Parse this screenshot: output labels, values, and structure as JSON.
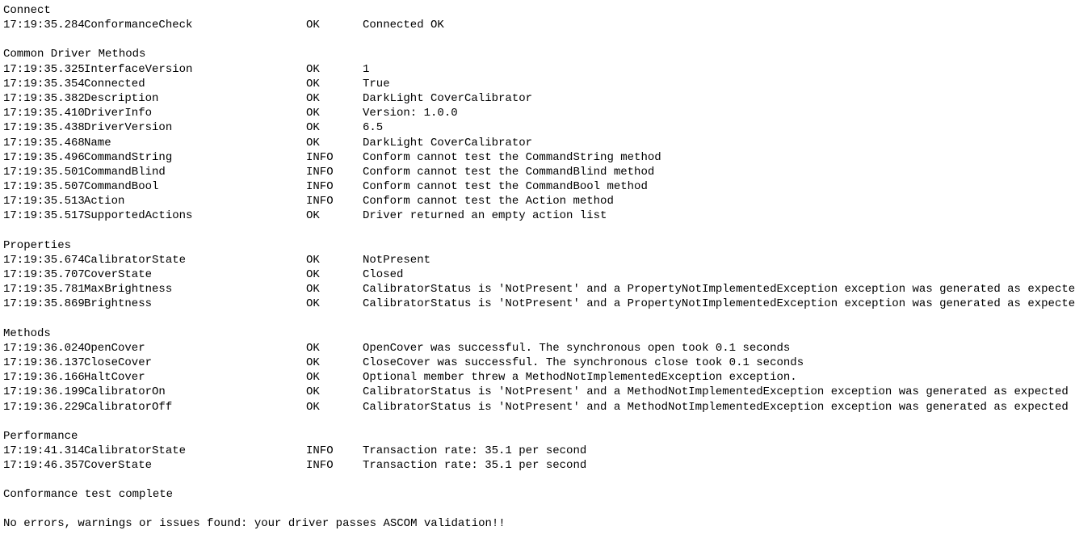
{
  "sections": [
    {
      "title": "Connect",
      "firstTop": false,
      "rows": [
        {
          "ts": "17:19:35.284",
          "name": "ConformanceCheck",
          "status": "OK",
          "msg": "Connected OK"
        }
      ]
    },
    {
      "title": "Common Driver Methods",
      "rows": [
        {
          "ts": "17:19:35.325",
          "name": "InterfaceVersion",
          "status": "OK",
          "msg": "1"
        },
        {
          "ts": "17:19:35.354",
          "name": "Connected",
          "status": "OK",
          "msg": "True"
        },
        {
          "ts": "17:19:35.382",
          "name": "Description",
          "status": "OK",
          "msg": "DarkLight CoverCalibrator"
        },
        {
          "ts": "17:19:35.410",
          "name": "DriverInfo",
          "status": "OK",
          "msg": "Version: 1.0.0"
        },
        {
          "ts": "17:19:35.438",
          "name": "DriverVersion",
          "status": "OK",
          "msg": "6.5"
        },
        {
          "ts": "17:19:35.468",
          "name": "Name",
          "status": "OK",
          "msg": "DarkLight CoverCalibrator"
        },
        {
          "ts": "17:19:35.496",
          "name": "CommandString",
          "status": "INFO",
          "msg": "Conform cannot test the CommandString method"
        },
        {
          "ts": "17:19:35.501",
          "name": "CommandBlind",
          "status": "INFO",
          "msg": "Conform cannot test the CommandBlind method"
        },
        {
          "ts": "17:19:35.507",
          "name": "CommandBool",
          "status": "INFO",
          "msg": "Conform cannot test the CommandBool method"
        },
        {
          "ts": "17:19:35.513",
          "name": "Action",
          "status": "INFO",
          "msg": "Conform cannot test the Action method"
        },
        {
          "ts": "17:19:35.517",
          "name": "SupportedActions",
          "status": "OK",
          "msg": "Driver returned an empty action list"
        }
      ]
    },
    {
      "title": "Properties",
      "rows": [
        {
          "ts": "17:19:35.674",
          "name": "CalibratorState",
          "status": "OK",
          "msg": "NotPresent"
        },
        {
          "ts": "17:19:35.707",
          "name": "CoverState",
          "status": "OK",
          "msg": "Closed"
        },
        {
          "ts": "17:19:35.781",
          "name": "MaxBrightness",
          "status": "OK",
          "msg": "CalibratorStatus is 'NotPresent' and a PropertyNotImplementedException exception was generated as expected"
        },
        {
          "ts": "17:19:35.869",
          "name": "Brightness",
          "status": "OK",
          "msg": "CalibratorStatus is 'NotPresent' and a PropertyNotImplementedException exception was generated as expected"
        }
      ]
    },
    {
      "title": "Methods",
      "rows": [
        {
          "ts": "17:19:36.024",
          "name": "OpenCover",
          "status": "OK",
          "msg": "OpenCover was successful. The synchronous open took 0.1 seconds"
        },
        {
          "ts": "17:19:36.137",
          "name": "CloseCover",
          "status": "OK",
          "msg": "CloseCover was successful. The synchronous close took 0.1 seconds"
        },
        {
          "ts": "17:19:36.166",
          "name": "HaltCover",
          "status": "OK",
          "msg": "Optional member threw a MethodNotImplementedException exception."
        },
        {
          "ts": "17:19:36.199",
          "name": "CalibratorOn",
          "status": "OK",
          "msg": "CalibratorStatus is 'NotPresent' and a MethodNotImplementedException exception was generated as expected"
        },
        {
          "ts": "17:19:36.229",
          "name": "CalibratorOff",
          "status": "OK",
          "msg": "CalibratorStatus is 'NotPresent' and a MethodNotImplementedException exception was generated as expected"
        }
      ]
    },
    {
      "title": "Performance",
      "rows": [
        {
          "ts": "17:19:41.314",
          "name": "CalibratorState",
          "status": "INFO",
          "msg": "Transaction rate: 35.1 per second"
        },
        {
          "ts": "17:19:46.357",
          "name": "CoverState",
          "status": "INFO",
          "msg": "Transaction rate: 35.1 per second"
        }
      ]
    }
  ],
  "footer1": "Conformance test complete",
  "footer2": "No errors, warnings or issues found: your driver passes ASCOM validation!!"
}
